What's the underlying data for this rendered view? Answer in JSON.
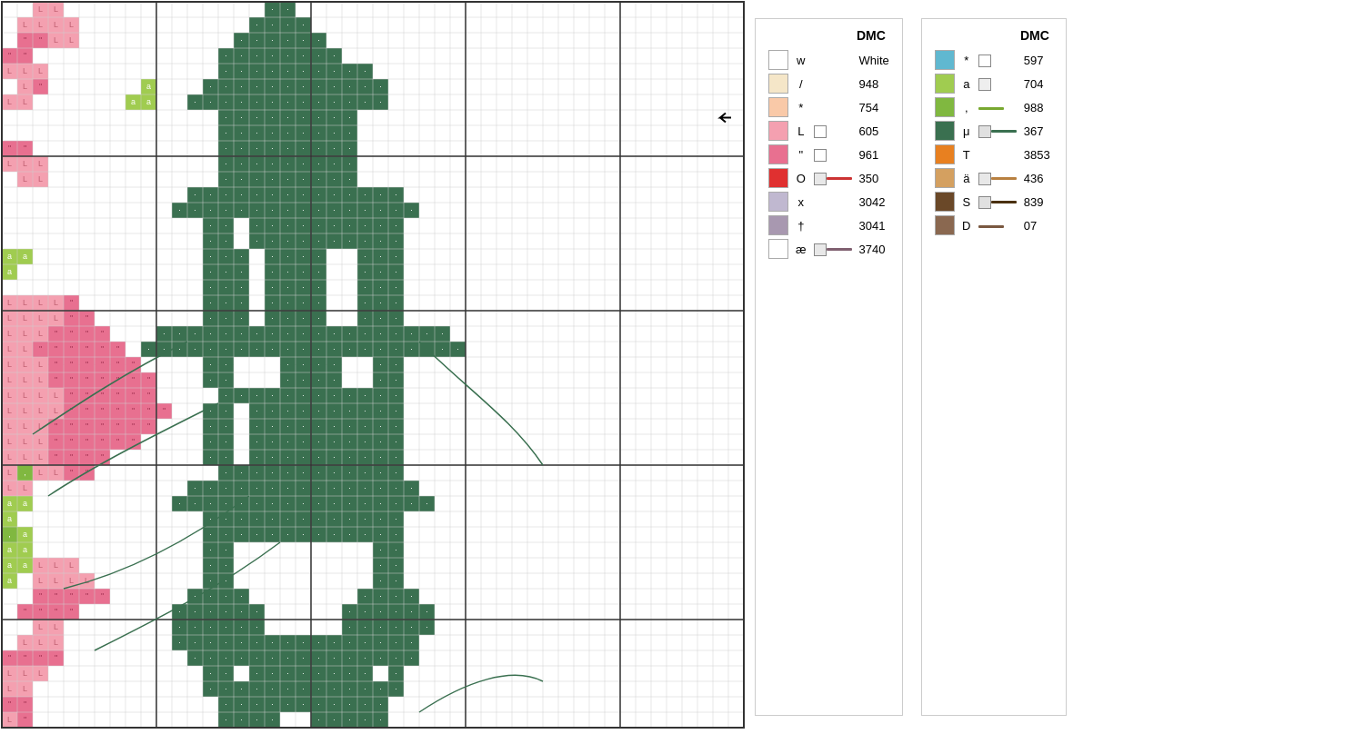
{
  "legend": {
    "title": "DMC",
    "left_items": [
      {
        "color": "#ffffff",
        "symbol": "w",
        "mini": null,
        "line": null,
        "dmc": "White"
      },
      {
        "color": "#f5e6c8",
        "symbol": "/",
        "mini": null,
        "line": null,
        "dmc": "948"
      },
      {
        "color": "#f9c9a8",
        "symbol": "*",
        "mini": null,
        "line": null,
        "dmc": "754"
      },
      {
        "color": "#f4a0b0",
        "symbol": "L",
        "mini": "#fff",
        "line": null,
        "dmc": "605"
      },
      {
        "color": "#e87090",
        "symbol": "\"",
        "mini": "#fff",
        "line": null,
        "dmc": "961"
      },
      {
        "color": "#e03030",
        "symbol": "O",
        "mini": "#e8e8e8",
        "line": "#cc3333",
        "dmc": "350"
      },
      {
        "color": "#c0b8d0",
        "symbol": "x",
        "mini": null,
        "line": null,
        "dmc": "3042"
      },
      {
        "color": "#a898b0",
        "symbol": "†",
        "mini": null,
        "line": null,
        "dmc": "3041"
      },
      {
        "color": "#7060808",
        "symbol": "æ",
        "mini": "#e8e8e8",
        "line": "#806070",
        "dmc": "3740"
      }
    ],
    "right_items": [
      {
        "color": "#60b8d0",
        "symbol": "*",
        "mini": "#fff",
        "line": null,
        "dmc": "597"
      },
      {
        "color": "#a0cc50",
        "symbol": "a",
        "mini": "#eee",
        "line": null,
        "dmc": "704"
      },
      {
        "color": "#80b840",
        "symbol": ",",
        "mini": null,
        "line": "#78a830",
        "dmc": "988"
      },
      {
        "color": "#3a7050",
        "symbol": "μ",
        "mini": "#e0e0e0",
        "line": "#3a7050",
        "dmc": "367"
      },
      {
        "color": "#e88020",
        "symbol": "T",
        "mini": null,
        "line": null,
        "dmc": "3853"
      },
      {
        "color": "#d4a060",
        "symbol": "ä",
        "mini": "#e8e8e8",
        "line": "#b88040",
        "dmc": "436"
      },
      {
        "color": "#6a4828",
        "symbol": "S",
        "mini": "#e0e0e0",
        "line": "#4a3010",
        "dmc": "839"
      },
      {
        "color": "#8a6850",
        "symbol": "D",
        "mini": null,
        "line": "#7a5840",
        "dmc": "07"
      }
    ]
  },
  "grid": {
    "cell_size": 17,
    "cols": 48,
    "rows": 47,
    "arrow_col": 46,
    "arrow_row": 7
  }
}
